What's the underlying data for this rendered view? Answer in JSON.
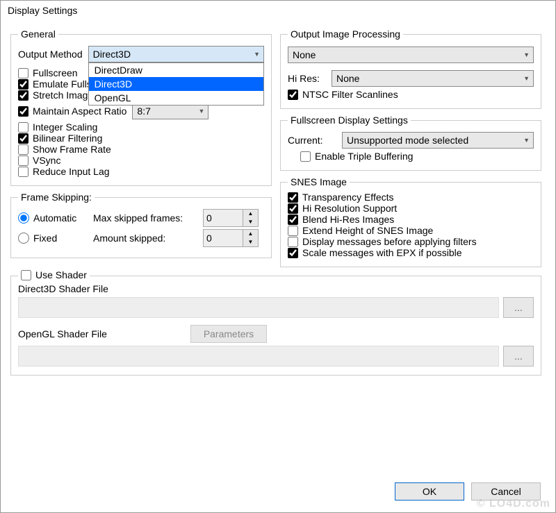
{
  "window": {
    "title": "Display Settings"
  },
  "general": {
    "legend": "General",
    "output_method_label": "Output Method",
    "output_method_value": "Direct3D",
    "output_method_options": {
      "o0": "DirectDraw",
      "o1": "Direct3D",
      "o2": "OpenGL"
    },
    "fullscreen": "Fullscreen",
    "emulate_fullscreen": "Emulate Fullscreen",
    "stretch": "Stretch Image",
    "aspect": "Maintain Aspect Ratio",
    "aspect_value": "8:7",
    "integer": "Integer Scaling",
    "bilinear": "Bilinear Filtering",
    "framerate": "Show Frame Rate",
    "vsync": "VSync",
    "inputlag": "Reduce Input Lag"
  },
  "frameskip": {
    "legend": "Frame Skipping:",
    "auto": "Automatic",
    "fixed": "Fixed",
    "max_label": "Max skipped frames:",
    "max_value": "0",
    "amount_label": "Amount skipped:",
    "amount_value": "0"
  },
  "output_proc": {
    "legend": "Output Image Processing",
    "value": "None",
    "hires_label": "Hi Res:",
    "hires_value": "None",
    "ntsc": "NTSC Filter Scanlines"
  },
  "fs_display": {
    "legend": "Fullscreen Display Settings",
    "current_label": "Current:",
    "current_value": "Unsupported mode selected",
    "triple": "Enable Triple Buffering"
  },
  "snes": {
    "legend": "SNES Image",
    "transparency": "Transparency Effects",
    "hires_support": "Hi Resolution Support",
    "blend": "Blend Hi-Res Images",
    "extend": "Extend Height of SNES Image",
    "display_msg": "Display messages before applying filters",
    "scale_msg": "Scale messages with EPX if possible"
  },
  "shader": {
    "use": "Use Shader",
    "d3d_label": "Direct3D Shader File",
    "ogl_label": "OpenGL Shader File",
    "params": "Parameters",
    "browse": "..."
  },
  "buttons": {
    "ok": "OK",
    "cancel": "Cancel"
  },
  "watermark": "© LO4D.com"
}
